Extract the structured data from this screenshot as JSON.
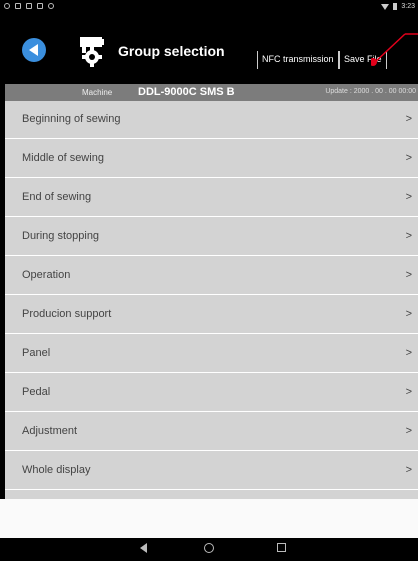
{
  "status_bar": {
    "time": "3:23"
  },
  "header": {
    "title": "Group selection",
    "nfc_button": "NFC transmission",
    "save_button": "Save File"
  },
  "machine_bar": {
    "label": "Machine",
    "value": "DDL-9000C SMS B",
    "update": "Update : 2000 . 00 . 00  00:00"
  },
  "list": {
    "arrow": ">",
    "items": [
      "Beginning of sewing",
      "Middle of sewing",
      "End of sewing",
      "During stopping",
      "Operation",
      "Producion support",
      "Panel",
      "Pedal",
      "Adjustment",
      "Whole display"
    ]
  },
  "colors": {
    "accent": "#3b8fde",
    "annotation": "#e3001b",
    "list_bg": "#d3d3d3",
    "machine_bar": "#7c7c7c"
  },
  "icons": {
    "back": "back-arrow-icon",
    "group": "machine-gear-icon",
    "nav": [
      "nav-back-icon",
      "nav-home-icon",
      "nav-recent-icon"
    ]
  }
}
